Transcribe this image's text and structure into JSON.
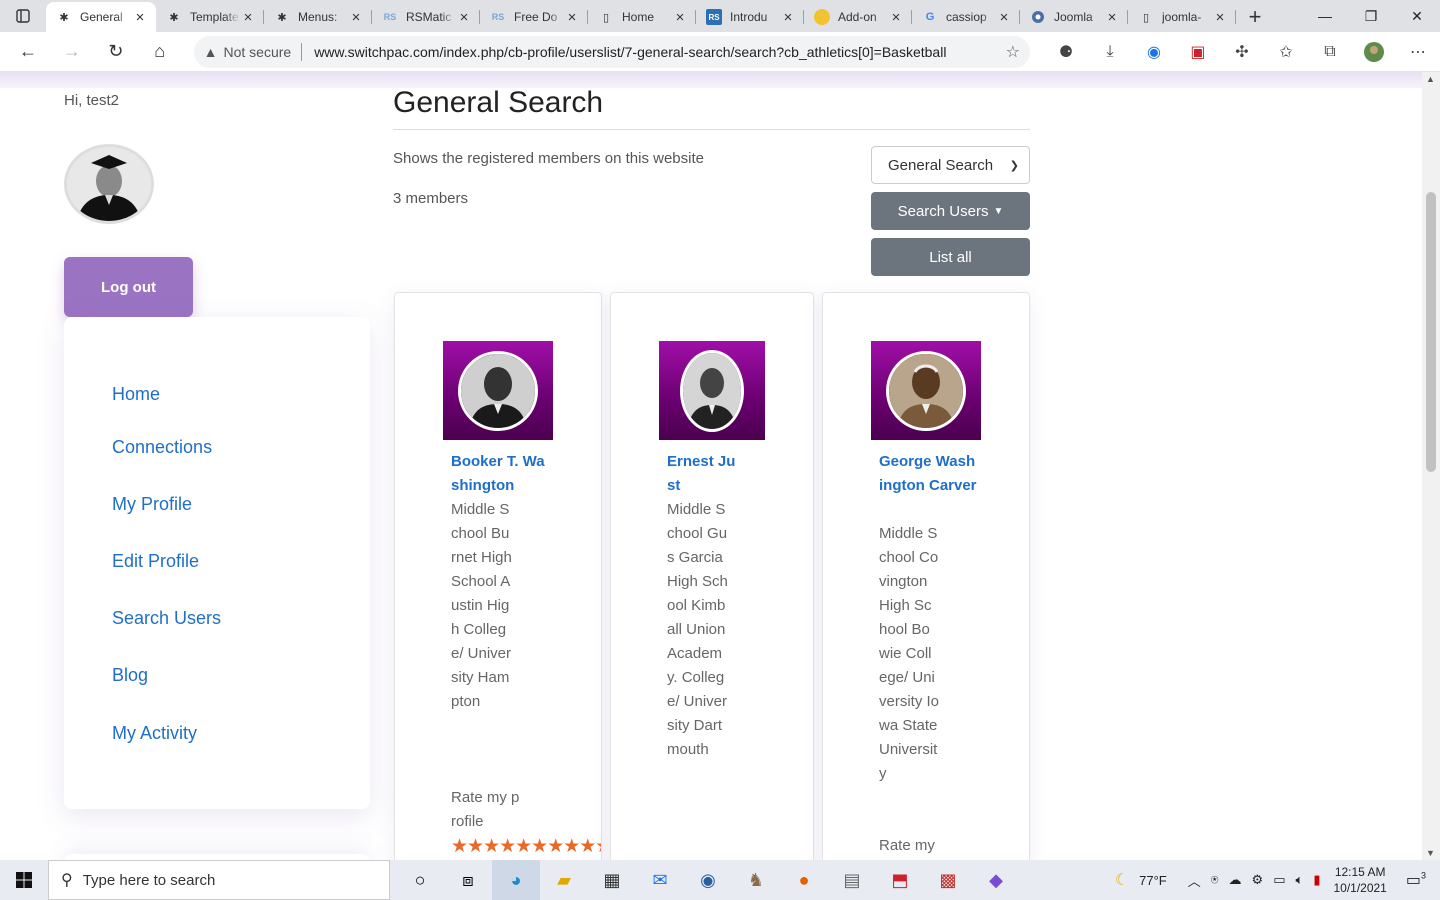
{
  "browser": {
    "tabs": [
      {
        "label": "General",
        "favicon": "joomla-icon",
        "active": true
      },
      {
        "label": "Templates",
        "favicon": "joomla-icon"
      },
      {
        "label": "Menus:",
        "favicon": "joomla-icon"
      },
      {
        "label": "RSMatic",
        "favicon": "rs-icon"
      },
      {
        "label": "Free Do",
        "favicon": "rs-icon"
      },
      {
        "label": "Home",
        "favicon": "page-icon"
      },
      {
        "label": "Introdu",
        "favicon": "rs-icon"
      },
      {
        "label": "Add-on",
        "favicon": "addon-icon"
      },
      {
        "label": "cassiop",
        "favicon": "google-icon"
      },
      {
        "label": "Joomla",
        "favicon": "chrome-icon"
      },
      {
        "label": "joomla-",
        "favicon": "page-icon"
      }
    ],
    "security_label": "Not secure",
    "url": "www.switchpac.com/index.php/cb-profile/userslist/7-general-search/search?cb_athletics[0]=Basketball"
  },
  "sidebar": {
    "greeting": "Hi, test2",
    "logout_label": "Log out",
    "nav": [
      {
        "label": "Home"
      },
      {
        "label": "Connections"
      },
      {
        "label": "My Profile"
      },
      {
        "label": "Edit Profile"
      },
      {
        "label": "Search Users"
      },
      {
        "label": "Blog"
      },
      {
        "label": "My Activity"
      }
    ]
  },
  "main": {
    "title": "General Search",
    "description": "Shows the registered members on this website",
    "member_count": "3 members",
    "list_select": "General Search",
    "search_users_label": "Search Users",
    "list_all_label": "List all"
  },
  "members": [
    {
      "name": "Booker T. Washington",
      "info": "Middle School Burnet High School Austin High College/ University Hampton",
      "rate_label": "Rate my profile",
      "stars": 10
    },
    {
      "name": "Ernest Just",
      "info": "Middle School Gus Garcia High School Kimball Union Academy. College/ University Dartmouth",
      "rate_label": "",
      "stars": 0
    },
    {
      "name": "George Washington Carver",
      "info": "Middle School Covington High School Bowie College/ University Iowa State University",
      "rate_label": "Rate my",
      "stars": 0
    }
  ],
  "taskbar": {
    "search_placeholder": "Type here to search",
    "weather": "77°F",
    "time": "12:15 AM",
    "date": "10/1/2021",
    "notification_count": "3"
  },
  "colors": {
    "accent_purple": "#9b73c3",
    "link_blue": "#1f6fca",
    "button_gray": "#6c757d",
    "star_orange": "#e8692a",
    "photo_magenta": "#8b0a91"
  }
}
